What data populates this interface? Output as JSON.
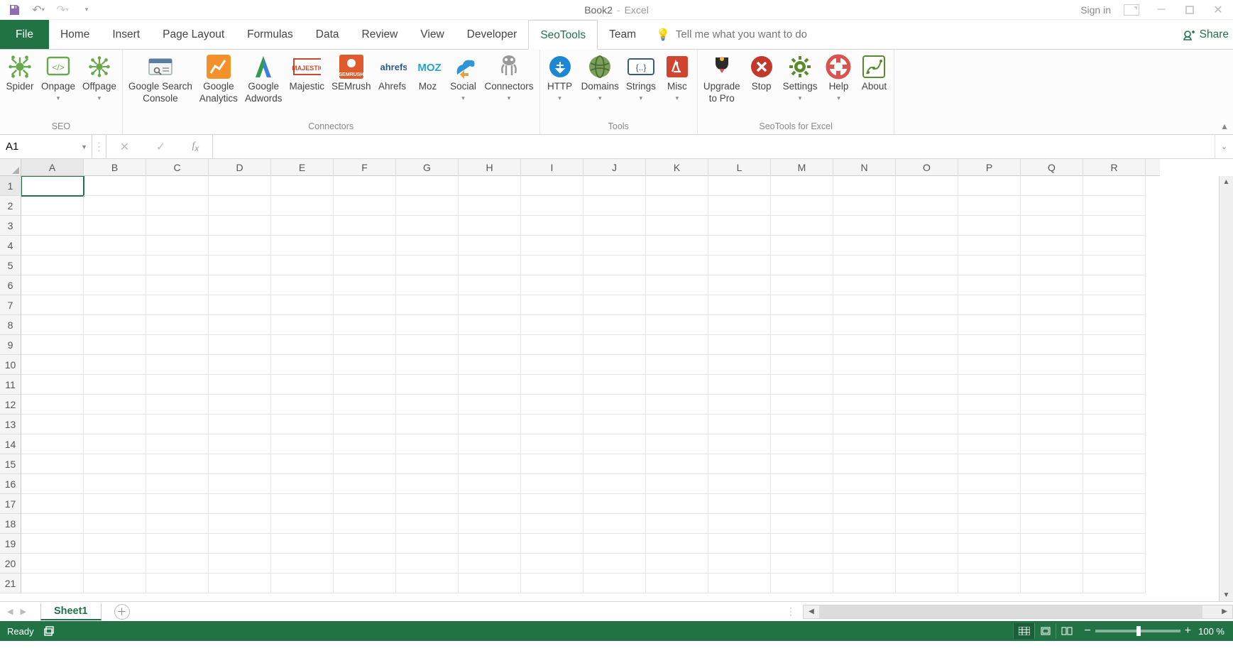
{
  "title": {
    "document": "Book2",
    "separator": "-",
    "app": "Excel"
  },
  "signin_label": "Sign in",
  "share_label": "Share",
  "tabs": {
    "file": "File",
    "items": [
      "Home",
      "Insert",
      "Page Layout",
      "Formulas",
      "Data",
      "Review",
      "View",
      "Developer",
      "SeoTools",
      "Team"
    ],
    "active_index": 8
  },
  "tellme": {
    "placeholder": "Tell me what you want to do"
  },
  "ribbon": {
    "groups": [
      {
        "label": "SEO",
        "buttons": [
          {
            "name": "spider",
            "label": "Spider",
            "color": "#6aa84f"
          },
          {
            "name": "onpage",
            "label": "Onpage",
            "color": "#6aa84f",
            "dropdown": true
          },
          {
            "name": "offpage",
            "label": "Offpage",
            "color": "#6aa84f",
            "dropdown": true
          }
        ]
      },
      {
        "label": "Connectors",
        "buttons": [
          {
            "name": "google-search-console",
            "label": "Google Search\nConsole",
            "color": "#5b7ca3",
            "twoline": true
          },
          {
            "name": "google-analytics",
            "label": "Google\nAnalytics",
            "color": "#f5912a",
            "twoline": true
          },
          {
            "name": "google-adwords",
            "label": "Google\nAdwords",
            "color": "#3f7de0",
            "twoline": true
          },
          {
            "name": "majestic",
            "label": "Majestic",
            "color": "#c9472f"
          },
          {
            "name": "semrush",
            "label": "SEMrush",
            "color": "#e05a2b"
          },
          {
            "name": "ahrefs",
            "label": "Ahrefs",
            "color": "#e6852e"
          },
          {
            "name": "moz",
            "label": "Moz",
            "color": "#29a3c9"
          },
          {
            "name": "social",
            "label": "Social",
            "color": "#2f95d6",
            "dropdown": true
          },
          {
            "name": "connectors",
            "label": "Connectors",
            "color": "#777",
            "dropdown": true
          }
        ]
      },
      {
        "label": "Tools",
        "buttons": [
          {
            "name": "http",
            "label": "HTTP",
            "color": "#1e87d4",
            "dropdown": true
          },
          {
            "name": "domains",
            "label": "Domains",
            "color": "#5a874a",
            "dropdown": true
          },
          {
            "name": "strings",
            "label": "Strings",
            "color": "#3b5c79",
            "dropdown": true
          },
          {
            "name": "misc",
            "label": "Misc",
            "color": "#d04430",
            "dropdown": true
          }
        ]
      },
      {
        "label": "SeoTools for Excel",
        "buttons": [
          {
            "name": "upgrade",
            "label": "Upgrade\nto Pro",
            "color": "#333",
            "twoline": true
          },
          {
            "name": "stop",
            "label": "Stop",
            "color": "#c0392b"
          },
          {
            "name": "settings",
            "label": "Settings",
            "color": "#5a8a2e",
            "dropdown": true
          },
          {
            "name": "help",
            "label": "Help",
            "color": "#d9534f",
            "dropdown": true
          },
          {
            "name": "about",
            "label": "About",
            "color": "#5a8a2e"
          }
        ]
      }
    ]
  },
  "namebox": {
    "value": "A1"
  },
  "formula": {
    "value": ""
  },
  "columns": [
    "A",
    "B",
    "C",
    "D",
    "E",
    "F",
    "G",
    "H",
    "I",
    "J",
    "K",
    "L",
    "M",
    "N",
    "O",
    "P",
    "Q",
    "R"
  ],
  "rows": [
    "1",
    "2",
    "3",
    "4",
    "5",
    "6",
    "7",
    "8",
    "9",
    "10",
    "11",
    "12",
    "13",
    "14",
    "15",
    "16",
    "17",
    "18",
    "19",
    "20",
    "21"
  ],
  "active_cell": {
    "row": 0,
    "col": 0
  },
  "sheet": {
    "name": "Sheet1"
  },
  "status": {
    "ready": "Ready",
    "zoom": "100 %"
  }
}
